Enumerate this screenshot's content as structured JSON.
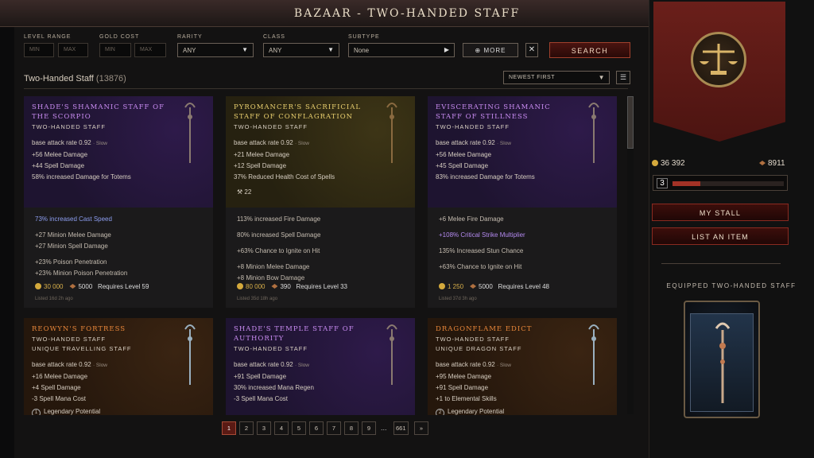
{
  "window": {
    "title": "BAZAAR - TWO-HANDED STAFF"
  },
  "filters": {
    "level_range": {
      "label": "LEVEL RANGE",
      "min": "MIN",
      "max": "MAX"
    },
    "gold_cost": {
      "label": "GOLD COST",
      "min": "MIN",
      "max": "MAX"
    },
    "rarity": {
      "label": "RARITY",
      "value": "ANY"
    },
    "class": {
      "label": "CLASS",
      "value": "ANY"
    },
    "subtype": {
      "label": "SUBTYPE",
      "value": "None"
    },
    "more_label": "MORE",
    "search_label": "SEARCH"
  },
  "results": {
    "title": "Two-Handed Staff",
    "count": "(13876)",
    "sort": "NEWEST FIRST"
  },
  "cards": [
    {
      "rarity": "purple",
      "name": "Shade's Shamanic Staff of the Scorpio",
      "type": "Two-Handed Staff",
      "subtype": "",
      "stats": [
        "base attack rate 0.92 · Slow",
        "+56 Melee Damage",
        "+44 Spell Damage",
        "58% increased Damage for Totems"
      ],
      "mods": [
        "73% increased Cast Speed",
        "+27 Minion Melee Damage",
        "+27 Minion Spell Damage",
        "+23% Poison Penetration",
        "+23% Minion Poison Penetration"
      ],
      "price": "30 000",
      "shards": "5000",
      "req": "Requires Level 59",
      "listed": "Listed 16d 2h ago"
    },
    {
      "rarity": "gold",
      "name": "Pyromancer's Sacrificial Staff of Conflagration",
      "type": "Two-Handed Staff",
      "subtype": "",
      "stats": [
        "base attack rate 0.92 · Slow",
        "+21 Melee Damage",
        "+12 Spell Damage",
        "37% Reduced Health Cost of Spells"
      ],
      "extra": "22",
      "mods": [
        "113% increased Fire Damage",
        "80% increased Spell Damage",
        "+63% Chance to Ignite on Hit",
        "+8 Minion Melee Damage",
        "+8 Minion Bow Damage"
      ],
      "price": "80 000",
      "shards": "390",
      "req": "Requires Level 33",
      "listed": "Listed 35d 18h ago"
    },
    {
      "rarity": "purple",
      "name": "Eviscerating Shamanic Staff of Stillness",
      "type": "Two-Handed Staff",
      "subtype": "",
      "stats": [
        "base attack rate 0.92 · Slow",
        "+56 Melee Damage",
        "+45 Spell Damage",
        "83% increased Damage for Totems"
      ],
      "mods": [
        "+6 Melee Fire Damage",
        "+108% Critical Strike Multiplier",
        "135% Increased Stun Chance",
        "+63% Chance to Ignite on Hit"
      ],
      "price": "1 250",
      "shards": "5000",
      "req": "Requires Level 48",
      "listed": "Listed 37d 3h ago"
    },
    {
      "rarity": "orange",
      "name": "Reowyn's Fortress",
      "type": "Two-Handed Staff",
      "subtype": "Unique Travelling Staff",
      "stats": [
        "base attack rate 0.92 · Slow",
        "+16 Melee Damage",
        "+4 Spell Damage",
        "-3 Spell Mana Cost"
      ],
      "lp": "Legendary Potential",
      "lpn": "1"
    },
    {
      "rarity": "purple",
      "name": "Shade's Temple Staff of Authority",
      "type": "Two-Handed Staff",
      "subtype": "",
      "stats": [
        "base attack rate 0.92 · Slow",
        "+91 Spell Damage",
        "30% increased Mana Regen",
        "-3 Spell Mana Cost"
      ]
    },
    {
      "rarity": "orange",
      "name": "Dragonflame Edict",
      "type": "Two-Handed Staff",
      "subtype": "Unique Dragon Staff",
      "stats": [
        "base attack rate 0.92 · Slow",
        "+95 Melee Damage",
        "+91 Spell Damage",
        "+1 to Elemental Skills"
      ],
      "lp": "Legendary Potential",
      "lpn": "2"
    }
  ],
  "pagination": [
    "1",
    "2",
    "3",
    "4",
    "5",
    "6",
    "7",
    "8",
    "9",
    "...",
    "661",
    "»"
  ],
  "side": {
    "gold": "36 392",
    "shards": "8911",
    "level": "3",
    "level_progress": 0.25,
    "my_stall": "MY STALL",
    "list_item": "LIST AN ITEM",
    "equipped_title": "EQUIPPED TWO-HANDED STAFF"
  },
  "colors": {
    "accent": "#8a2a20",
    "unique": "#e9873a",
    "exalted": "#c98cf2",
    "set": "#e9cf6e"
  }
}
